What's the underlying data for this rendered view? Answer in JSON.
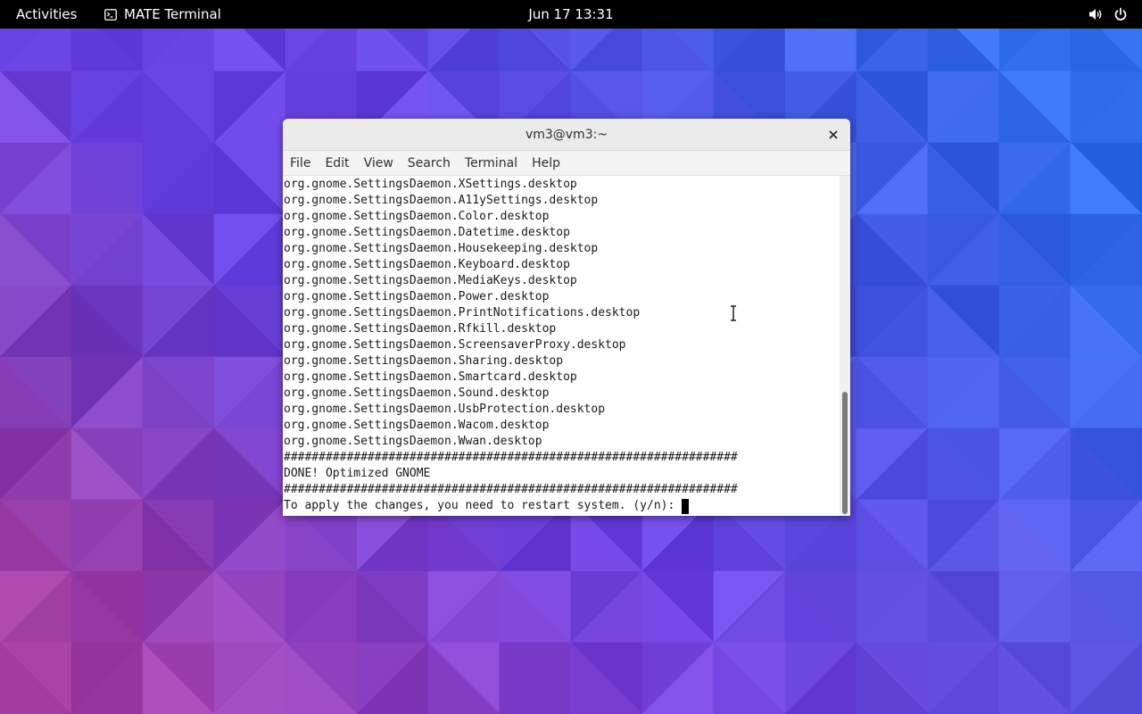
{
  "desktop": {
    "wallpaper_colors": [
      "#3a2fd2",
      "#5a3ee0",
      "#7b3fe0",
      "#9c3fd6",
      "#2f67e8",
      "#c4408c",
      "#4452e2",
      "#6a47e6",
      "#8848d8",
      "#2a7fe8"
    ]
  },
  "topbar": {
    "activities_label": "Activities",
    "app_name": "MATE Terminal",
    "app_icon": "terminal-icon",
    "clock_text": "Jun 17  13:31",
    "tray_icons": [
      "volume-icon",
      "power-icon"
    ]
  },
  "window": {
    "title": "vm3@vm3:~",
    "close_icon": "close-icon",
    "menu": [
      "File",
      "Edit",
      "View",
      "Search",
      "Terminal",
      "Help"
    ],
    "scroll_fraction": 1.0,
    "visible_fraction": 0.36,
    "terminal": {
      "lines": [
        "org.gnome.SettingsDaemon.XSettings.desktop",
        "org.gnome.SettingsDaemon.A11ySettings.desktop",
        "org.gnome.SettingsDaemon.Color.desktop",
        "org.gnome.SettingsDaemon.Datetime.desktop",
        "org.gnome.SettingsDaemon.Housekeeping.desktop",
        "org.gnome.SettingsDaemon.Keyboard.desktop",
        "org.gnome.SettingsDaemon.MediaKeys.desktop",
        "org.gnome.SettingsDaemon.Power.desktop",
        "org.gnome.SettingsDaemon.PrintNotifications.desktop",
        "org.gnome.SettingsDaemon.Rfkill.desktop",
        "org.gnome.SettingsDaemon.ScreensaverProxy.desktop",
        "org.gnome.SettingsDaemon.Sharing.desktop",
        "org.gnome.SettingsDaemon.Smartcard.desktop",
        "org.gnome.SettingsDaemon.Sound.desktop",
        "org.gnome.SettingsDaemon.UsbProtection.desktop",
        "org.gnome.SettingsDaemon.Wacom.desktop",
        "org.gnome.SettingsDaemon.Wwan.desktop",
        "#################################################################",
        "DONE! Optimized GNOME",
        "#################################################################"
      ],
      "prompt": "To apply the changes, you need to restart system. (y/n): "
    }
  }
}
